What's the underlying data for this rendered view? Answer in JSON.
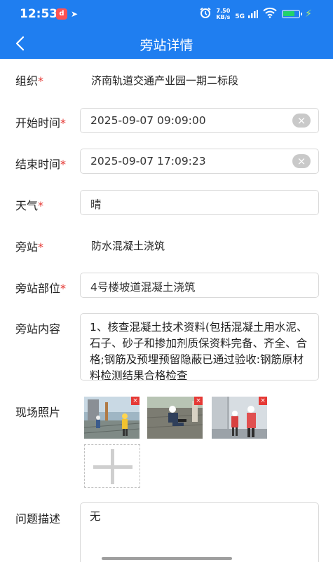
{
  "status_bar": {
    "time": "12:53",
    "net_speed_value": "7.50",
    "net_speed_unit": "KB/s",
    "network": "5G"
  },
  "header": {
    "title": "旁站详情"
  },
  "form": {
    "org": {
      "label": "组织",
      "required_mark": "*",
      "value": "济南轨道交通产业园一期二标段"
    },
    "start_time": {
      "label": "开始时间",
      "required_mark": "*",
      "value": "2025-09-07 09:09:00"
    },
    "end_time": {
      "label": "结束时间",
      "required_mark": "*",
      "value": "2025-09-07 17:09:23"
    },
    "weather": {
      "label": "天气",
      "required_mark": "*",
      "value": "晴"
    },
    "station": {
      "label": "旁站",
      "required_mark": "*",
      "value": "防水混凝土浇筑"
    },
    "station_location": {
      "label": "旁站部位",
      "required_mark": "*",
      "value": "4号楼坡道混凝土浇筑"
    },
    "station_content": {
      "label": "旁站内容",
      "value": "1、核查混凝土技术资料(包括混凝土用水泥、石子、砂子和掺加剂质保资料完备、齐全、合格;钢筋及预埋预留隐蔽已通过验收:钢筋原材料检测结果合格检查"
    },
    "photos": {
      "label": "现场照片",
      "count": 3,
      "delete_glyph": "×"
    },
    "issue": {
      "label": "问题描述",
      "value": "无"
    }
  },
  "colors": {
    "header_bg": "#1f7ef0",
    "required": "#e53935"
  },
  "icons": [
    "back-arrow-icon",
    "clear-icon",
    "delete-photo-icon",
    "add-photo-icon"
  ]
}
